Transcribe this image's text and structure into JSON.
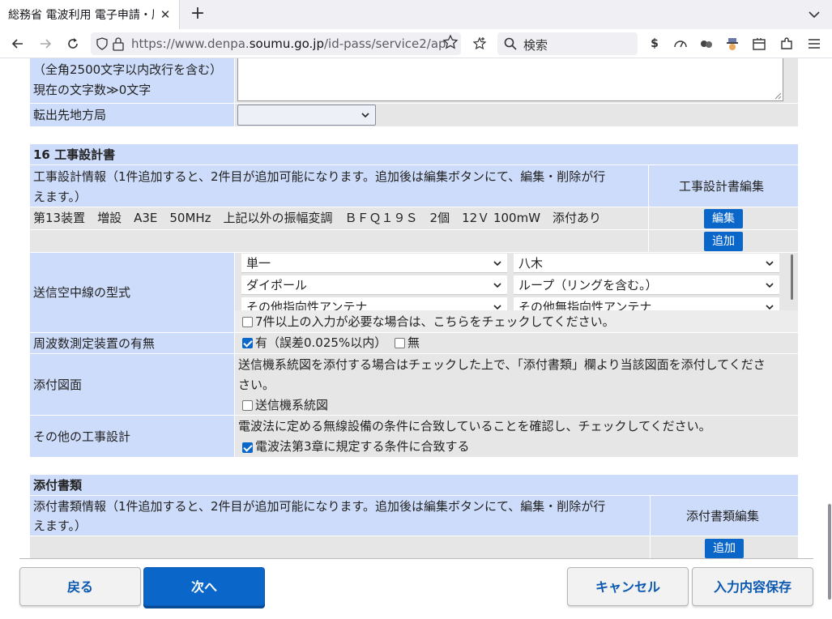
{
  "browser": {
    "tab_title": "総務省 電波利用 電子申請・届",
    "tab_close": "✕",
    "new_tab": "+",
    "url_prefix": "https://www.denpa.",
    "url_domain": "soumu.go.jp",
    "url_suffix": "/id-pass/service2/ap",
    "search_placeholder": "検索"
  },
  "top_form": {
    "remarks_hint_1": "（全角2500文字以内改行を含む）",
    "remarks_hint_2": "現在の文字数≫0文字",
    "transfer_label": "転出先地方局",
    "transfer_value": ""
  },
  "construction": {
    "heading": "16 工事設計書",
    "info_line_1": "工事設計情報（1件追加すると、2件目が追加可能になります。追加後は編集ボタンにて、編集・削除が行",
    "info_line_2": "えます。）",
    "edit_header": "工事設計書編集",
    "record": "第13装置　増設　A3E　50MHz　上記以外の振幅変調　ＢＦＱ１９Ｓ　2個　12Ｖ 100mW　添付あり",
    "edit_button": "編集",
    "add_button": "追加"
  },
  "antenna": {
    "label": "送信空中線の型式",
    "selects": [
      {
        "value": "単一"
      },
      {
        "value": "八木"
      },
      {
        "value": "ダイポール"
      },
      {
        "value": "ループ（リングを含む。）"
      },
      {
        "value": "その他指向性アンテナ"
      },
      {
        "value": "その他無指向性アンテナ"
      }
    ],
    "more_checkbox_label": "7件以上の入力が必要な場合は、こちらをチェックしてください。",
    "more_checked": false
  },
  "freq_measure": {
    "label": "周波数測定装置の有無",
    "option_yes": "有（誤差0.025%以内）",
    "option_no": "無",
    "yes_checked": true,
    "no_checked": false
  },
  "attach_drawing": {
    "label": "添付図面",
    "note_line_1": "送信機系統図を添付する場合はチェックした上で、「添付書類」欄より当該図面を添付してくださ",
    "note_line_2": "さい。",
    "checkbox_label": "送信機系統図",
    "checked": false
  },
  "other_design": {
    "label": "その他の工事設計",
    "note": "電波法に定める無線設備の条件に合致していることを確認し、チェックしてください。",
    "checkbox_label": "電波法第3章に規定する条件に合致する",
    "checked": true
  },
  "attachments": {
    "heading": "添付書類",
    "info_line_1": "添付書類情報（1件追加すると、2件目が追加可能になります。追加後は編集ボタンにて、編集・削除が行",
    "info_line_2": "えます。）",
    "edit_header": "添付書類編集",
    "add_button": "追加"
  },
  "footer": {
    "back": "戻る",
    "next": "次へ",
    "cancel": "キャンセル",
    "save": "入力内容保存"
  }
}
